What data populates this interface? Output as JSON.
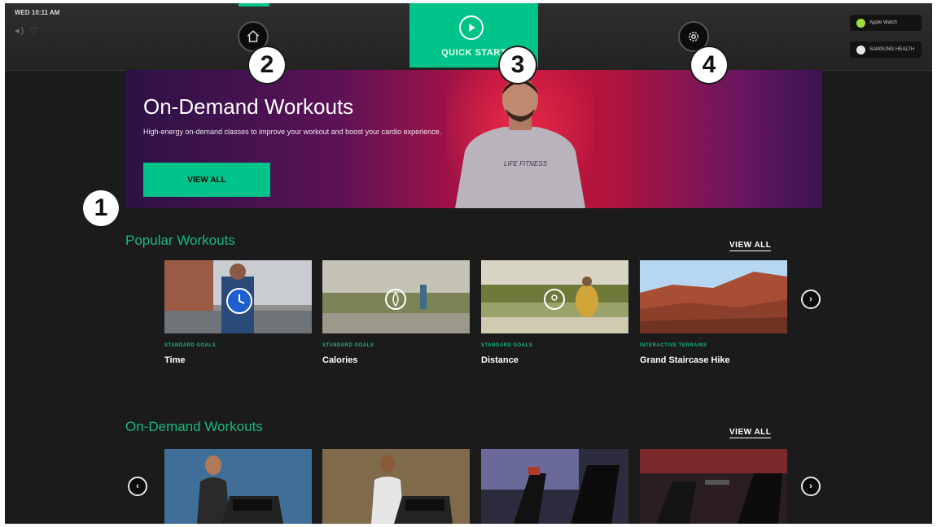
{
  "status": {
    "time": "WED 10:11 AM",
    "icons": "◂) ♡"
  },
  "nav": {
    "quick_start_label": "QUICK START",
    "badges": [
      {
        "text": "Apple Watch",
        "color": "#9be03a"
      },
      {
        "text": "SAMSUNG HEALTH",
        "color": "#e8e8e8"
      }
    ]
  },
  "callouts": [
    "1",
    "2",
    "3",
    "4"
  ],
  "hero": {
    "title": "On-Demand Workouts",
    "description": "High-energy on-demand classes to improve your workout and boost your cardio experience.",
    "button_label": "VIEW ALL",
    "shirt_text": "LIFE FITNESS"
  },
  "popular": {
    "title": "Popular Workouts",
    "view_all": "VIEW ALL",
    "cards": [
      {
        "category": "STANDARD GOALS",
        "title": "Time",
        "icon": "stopwatch-icon"
      },
      {
        "category": "STANDARD GOALS",
        "title": "Calories",
        "icon": "flame-icon"
      },
      {
        "category": "STANDARD GOALS",
        "title": "Distance",
        "icon": "location-pin-icon"
      },
      {
        "category": "INTERACTIVE TERRAINS",
        "title": "Grand Staircase Hike",
        "icon": ""
      }
    ]
  },
  "on_demand": {
    "title": "On-Demand Workouts",
    "view_all": "VIEW ALL"
  },
  "colors": {
    "accent": "#00c389",
    "section_title": "#19b97c",
    "background": "#1b1b1b"
  }
}
